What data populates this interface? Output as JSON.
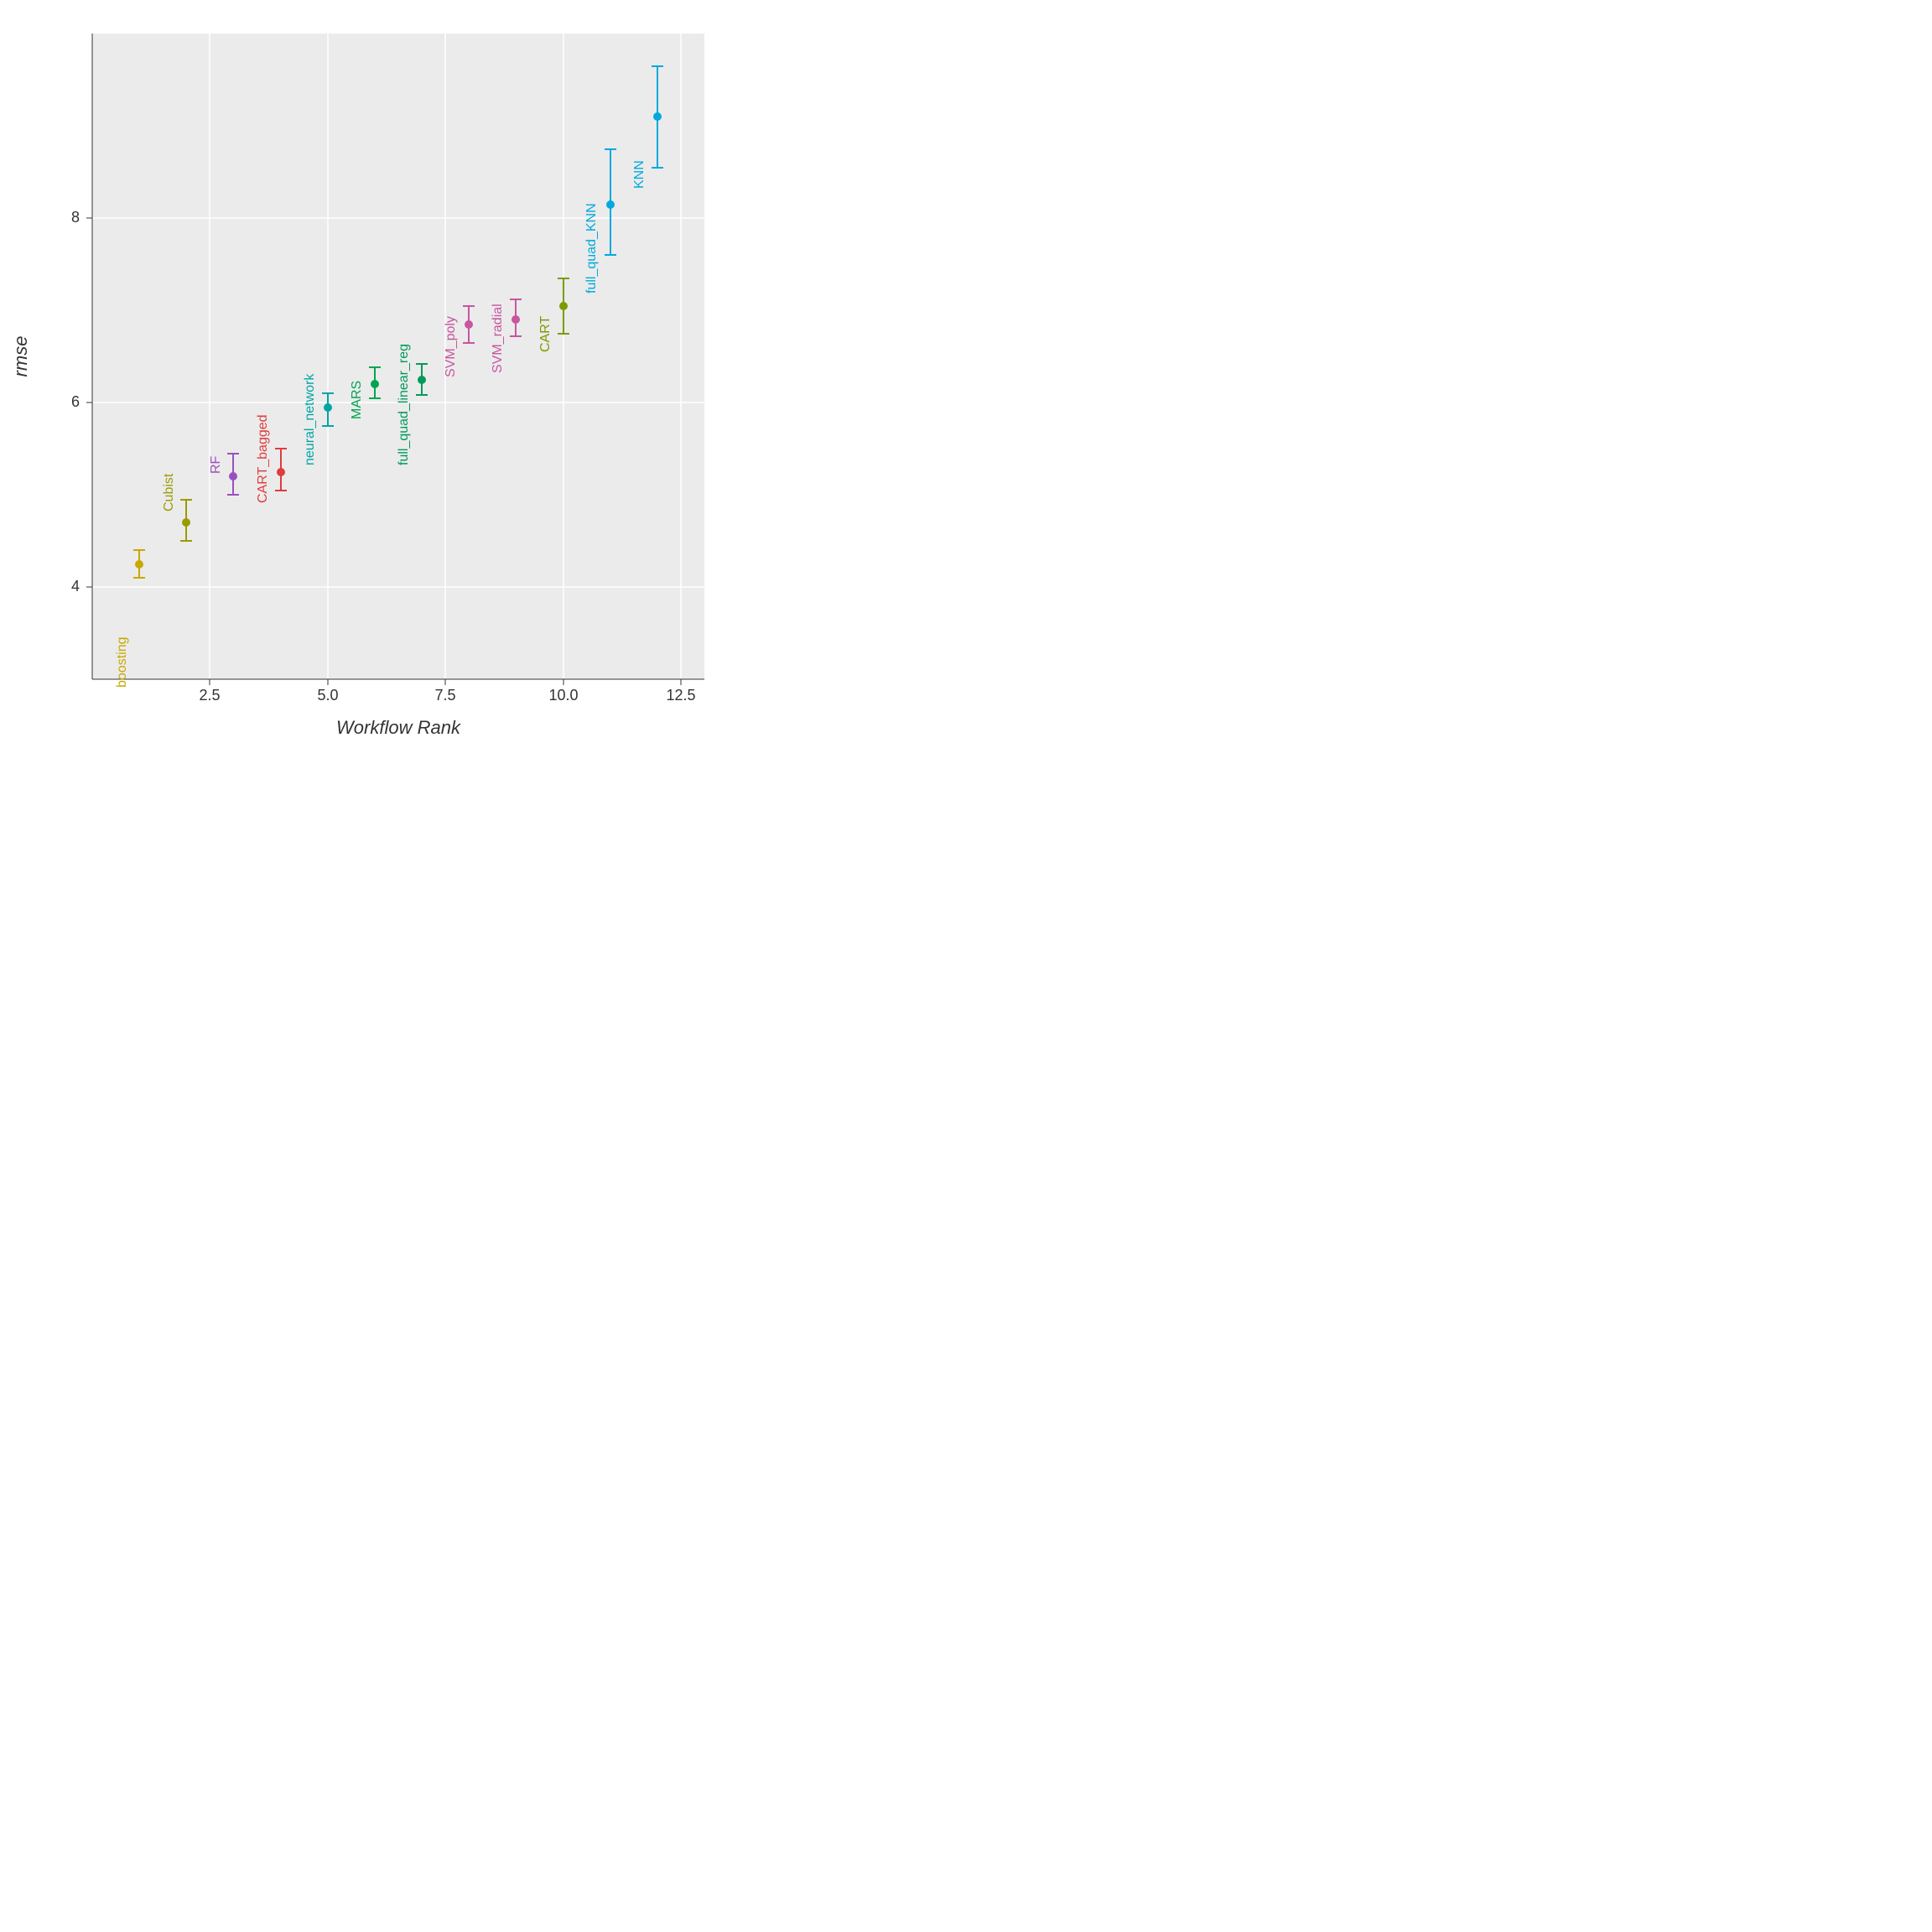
{
  "chart": {
    "title": "",
    "x_axis_label": "Workflow Rank",
    "y_axis_label": "rmse",
    "x_ticks": [
      "2.5",
      "5.0",
      "7.5",
      "10.0",
      "12.5"
    ],
    "y_ticks": [
      "4",
      "6",
      "8"
    ],
    "background": "#ebebeb",
    "grid_color": "#ffffff",
    "points": [
      {
        "name": "boosting",
        "x": 1,
        "y": 4.25,
        "y_low": 4.1,
        "y_high": 4.4,
        "color": "#C8A800",
        "label_color": "#C8A800"
      },
      {
        "name": "Cubist",
        "x": 2,
        "y": 4.7,
        "y_low": 4.5,
        "y_high": 4.95,
        "color": "#9B9B00",
        "label_color": "#9B9B00"
      },
      {
        "name": "RF",
        "x": 3,
        "y": 5.2,
        "y_low": 5.0,
        "y_high": 5.45,
        "color": "#9B4FBF",
        "label_color": "#9B4FBF"
      },
      {
        "name": "CART_bagged",
        "x": 4,
        "y": 5.25,
        "y_low": 5.05,
        "y_high": 5.5,
        "color": "#E03C3C",
        "label_color": "#E03C3C"
      },
      {
        "name": "neural_network",
        "x": 5,
        "y": 5.95,
        "y_low": 5.75,
        "y_high": 6.1,
        "color": "#00A5A5",
        "label_color": "#00A5A5"
      },
      {
        "name": "MARS",
        "x": 6,
        "y": 6.2,
        "y_low": 6.05,
        "y_high": 6.38,
        "color": "#00A550",
        "label_color": "#00A550"
      },
      {
        "name": "full_quad_linear_reg",
        "x": 7,
        "y": 6.25,
        "y_low": 6.08,
        "y_high": 6.42,
        "color": "#009B5A",
        "label_color": "#009B5A"
      },
      {
        "name": "SVM_poly",
        "x": 8,
        "y": 6.85,
        "y_low": 6.65,
        "y_high": 7.05,
        "color": "#C855A0",
        "label_color": "#C855A0"
      },
      {
        "name": "SVM_radial",
        "x": 9,
        "y": 6.9,
        "y_low": 6.72,
        "y_high": 7.12,
        "color": "#C855A0",
        "label_color": "#C855A0"
      },
      {
        "name": "CART",
        "x": 10,
        "y": 7.05,
        "y_low": 6.75,
        "y_high": 7.35,
        "color": "#7B9B00",
        "label_color": "#7B9B00"
      },
      {
        "name": "full_quad_KNN",
        "x": 11,
        "y": 8.15,
        "y_low": 7.6,
        "y_high": 8.75,
        "color": "#00AADC",
        "label_color": "#00AADC"
      },
      {
        "name": "KNN",
        "x": 12,
        "y": 9.1,
        "y_low": 8.55,
        "y_high": 9.65,
        "color": "#00AADC",
        "label_color": "#00AADC"
      }
    ]
  }
}
